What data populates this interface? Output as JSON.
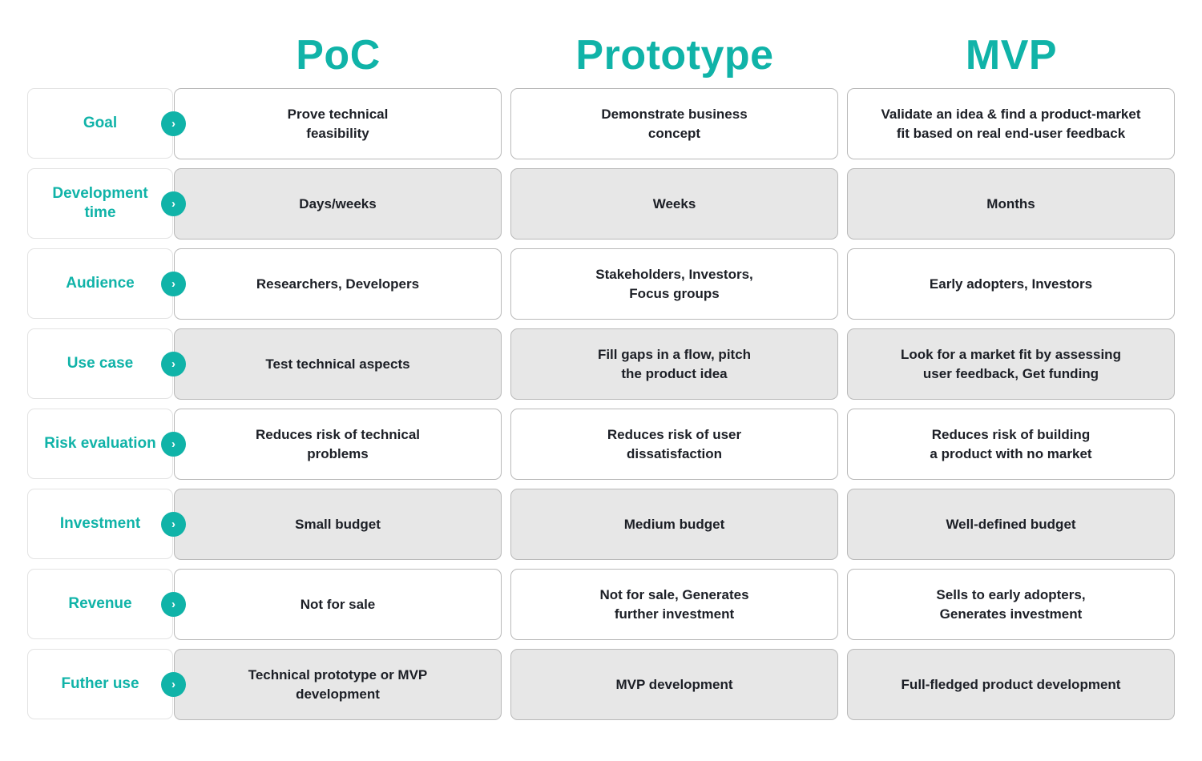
{
  "columns": [
    "PoC",
    "Prototype",
    "MVP"
  ],
  "accent_color": "#10b3a8",
  "arrow_icon": "chevron-right-icon",
  "arrow_glyph": "›",
  "rows": [
    {
      "label": "Goal",
      "cells": [
        "Prove technical\nfeasibility",
        "Demonstrate business\nconcept",
        "Validate an idea & find a product-market\nfit based on real end-user feedback"
      ]
    },
    {
      "label": "Development time",
      "cells": [
        "Days/weeks",
        "Weeks",
        "Months"
      ]
    },
    {
      "label": "Audience",
      "cells": [
        "Researchers, Developers",
        "Stakeholders, Investors,\nFocus groups",
        "Early adopters, Investors"
      ]
    },
    {
      "label": "Use case",
      "cells": [
        "Test technical aspects",
        "Fill gaps in a flow, pitch\nthe product idea",
        "Look for a market fit by assessing\nuser feedback, Get funding"
      ]
    },
    {
      "label": "Risk evaluation",
      "cells": [
        "Reduces risk of technical\nproblems",
        "Reduces risk of user\ndissatisfaction",
        "Reduces risk  of building\na product with no market"
      ]
    },
    {
      "label": "Investment",
      "cells": [
        "Small  budget",
        "Medium budget",
        "Well-defined budget"
      ]
    },
    {
      "label": "Revenue",
      "cells": [
        "Not for sale",
        "Not for sale, Generates\nfurther investment",
        "Sells to early adopters,\nGenerates investment"
      ]
    },
    {
      "label": "Futher use",
      "cells": [
        "Technical prototype or MVP\ndevelopment",
        "MVP development",
        "Full-fledged product development"
      ]
    }
  ]
}
